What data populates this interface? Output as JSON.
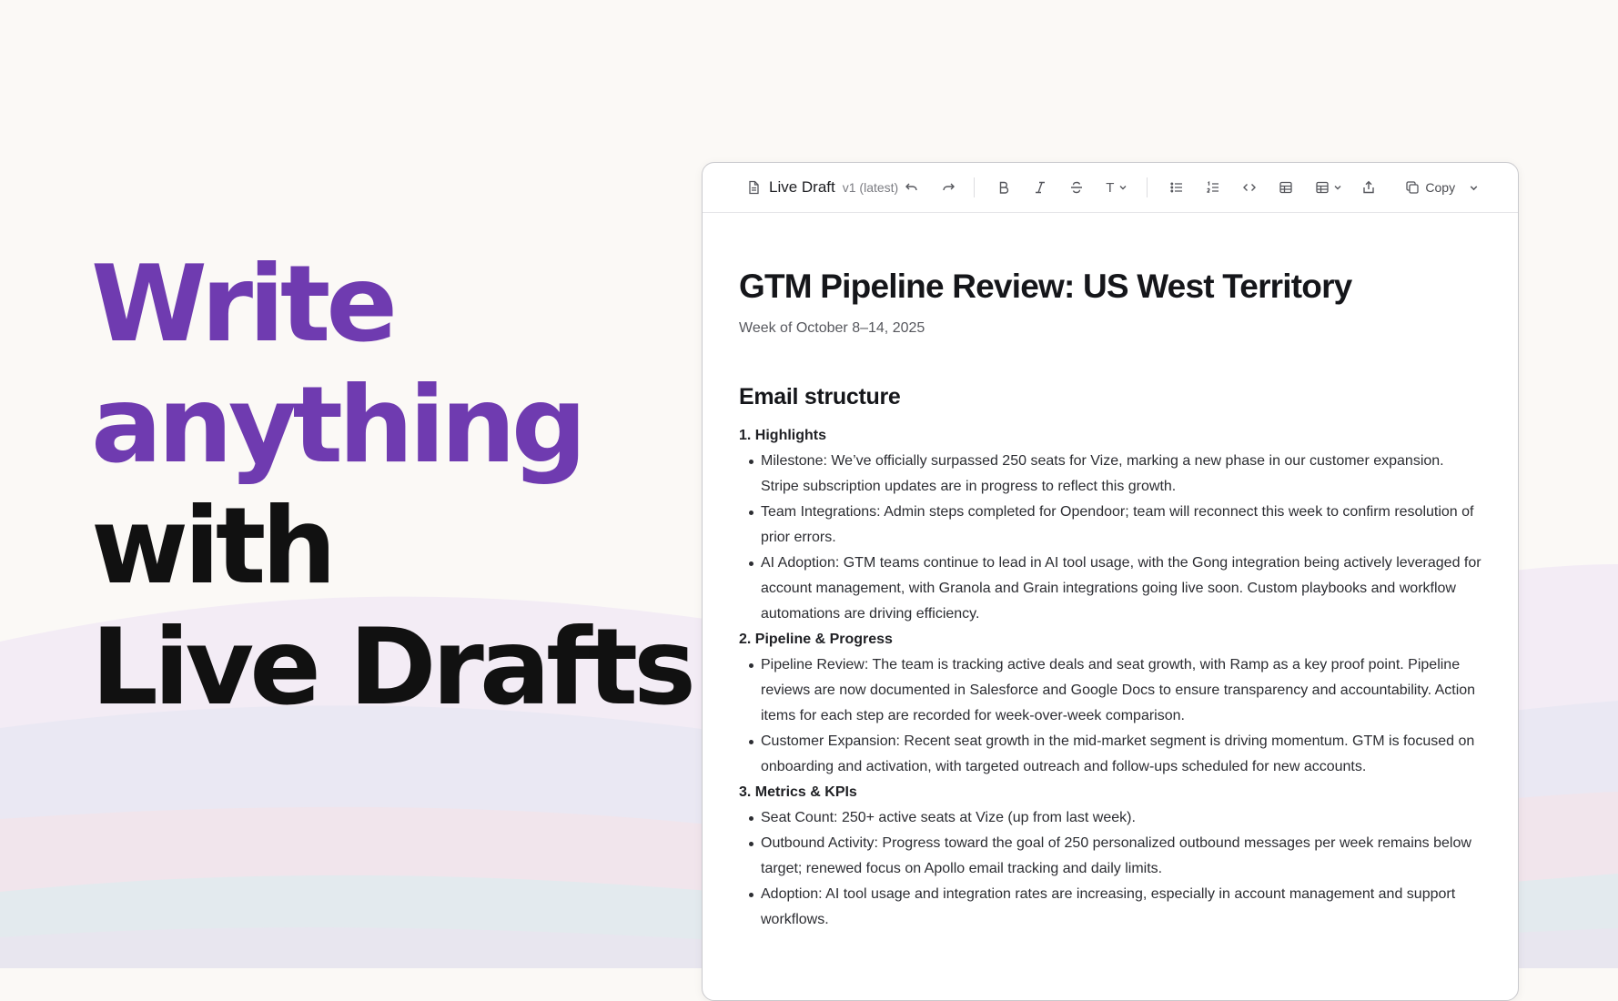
{
  "hero": {
    "line1": "Write",
    "line2": "anything",
    "line3": "with",
    "line4": "Live Drafts"
  },
  "colors": {
    "accent": "#6f3bb0",
    "heading": "#111111",
    "background": "#fbf9f6"
  },
  "toolbar": {
    "doc_icon": "document-icon",
    "doc_title": "Live Draft",
    "version": "v1 (latest)",
    "text_style_label": "T",
    "copy_label": "Copy",
    "icons": [
      "undo-icon",
      "redo-icon",
      "bold-icon",
      "italic-icon",
      "strikethrough-icon",
      "text-style-icon",
      "bullet-list-icon",
      "numbered-list-icon",
      "code-icon",
      "table-icon",
      "table-options-icon",
      "share-icon",
      "copy-icon",
      "chevron-down-icon"
    ]
  },
  "document": {
    "title": "GTM Pipeline Review:  US West Territory",
    "subtitle": "Week of October 8–14, 2025",
    "heading": "Email structure",
    "sections": [
      {
        "title": "1. Highlights",
        "bullets": [
          "Milestone: We’ve officially surpassed 250 seats for Vize, marking a new phase in our customer expansion. Stripe subscription updates are in progress to reflect this growth.",
          "Team Integrations: Admin steps completed for Opendoor; team will reconnect this week to confirm resolution of prior errors.",
          "AI Adoption: GTM teams continue to lead in AI tool usage, with the Gong integration being actively leveraged for account management, with Granola and Grain integrations going live soon. Custom playbooks and workflow automations are driving efficiency."
        ]
      },
      {
        "title": "2. Pipeline & Progress",
        "bullets": [
          "Pipeline Review: The team is tracking active deals and seat growth, with Ramp as a key proof point. Pipeline reviews are now documented in Salesforce and Google Docs to ensure transparency and accountability. Action items for each step are recorded for week-over-week comparison.",
          "Customer Expansion: Recent seat growth in the mid-market segment is driving momentum. GTM is focused on onboarding and activation, with targeted outreach and follow-ups scheduled for new accounts."
        ]
      },
      {
        "title": "3. Metrics & KPIs",
        "bullets": [
          "Seat Count: 250+ active seats at Vize (up from last week).",
          "Outbound Activity: Progress toward the goal of 250 personalized outbound messages per week remains below target; renewed focus on Apollo email tracking and daily limits.",
          "Adoption: AI tool usage and integration rates are increasing, especially in account management and support workflows."
        ]
      }
    ]
  }
}
